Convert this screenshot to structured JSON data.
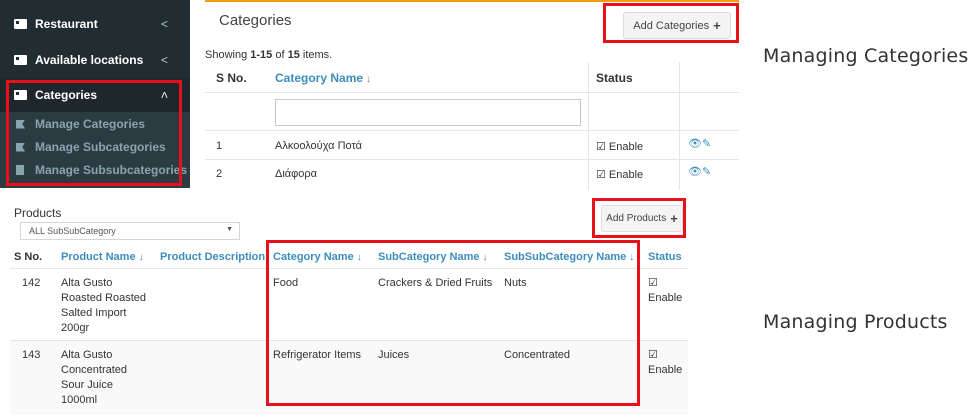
{
  "sidebar": {
    "items": [
      {
        "label": "Restaurant",
        "chevron": "<"
      },
      {
        "label": "Available locations",
        "chevron": "<"
      },
      {
        "label": "Categories",
        "chevron": "<"
      }
    ],
    "subitems": [
      {
        "label": "Manage Categories",
        "icon": "flag-icon"
      },
      {
        "label": "Manage Subcategories",
        "icon": "flag-icon"
      },
      {
        "label": "Manage Subsubcategories",
        "icon": "book-icon"
      }
    ]
  },
  "categories": {
    "title": "Categories",
    "add_button": "Add Categories",
    "plus": "+",
    "summary_prefix": "Showing ",
    "summary_range": "1-15",
    "summary_mid": " of ",
    "summary_total": "15",
    "summary_suffix": " items.",
    "headers": {
      "sno": "S No.",
      "name": "Category Name",
      "status": "Status",
      "sort": "↓"
    },
    "rows": [
      {
        "sno": "1",
        "name": "Αλκοολούχα Ποτά",
        "status": "☑ Enable"
      },
      {
        "sno": "2",
        "name": "Διάφορα",
        "status": "☑ Enable"
      }
    ]
  },
  "products": {
    "title": "Products",
    "filter_value": "ALL SubSubCategory",
    "add_button": "Add Products",
    "plus": "+",
    "headers": {
      "sno": "S No.",
      "name": "Product Name",
      "description": "Product Description",
      "category": "Category Name",
      "subcategory": "SubCategory Name",
      "subsubcategory": "SubSubCategory Name",
      "status": "Status",
      "sort": "↓"
    },
    "rows": [
      {
        "sno": "142",
        "name": [
          "Alta Gusto",
          "Roasted Roasted",
          "Salted Import",
          "200gr"
        ],
        "description": "",
        "category": "Food",
        "subcategory": "Crackers & Dried Fruits",
        "subsubcategory": "Nuts",
        "status": [
          "☑",
          "Enable"
        ]
      },
      {
        "sno": "143",
        "name": [
          "Alta Gusto",
          "Concentrated",
          "Sour Juice",
          "1000ml"
        ],
        "description": "",
        "category": "Refrigerator Items",
        "subcategory": "Juices",
        "subsubcategory": "Concentrated",
        "status": [
          "☑",
          "Enable"
        ]
      }
    ]
  },
  "captions": {
    "top": "Managing Categories",
    "bottom": "Managing Products"
  },
  "colors": {
    "sidebar_bg": "#222d32",
    "link": "#3c8dbc",
    "highlight": "#e8101b",
    "panel_accent": "#f39c12"
  }
}
